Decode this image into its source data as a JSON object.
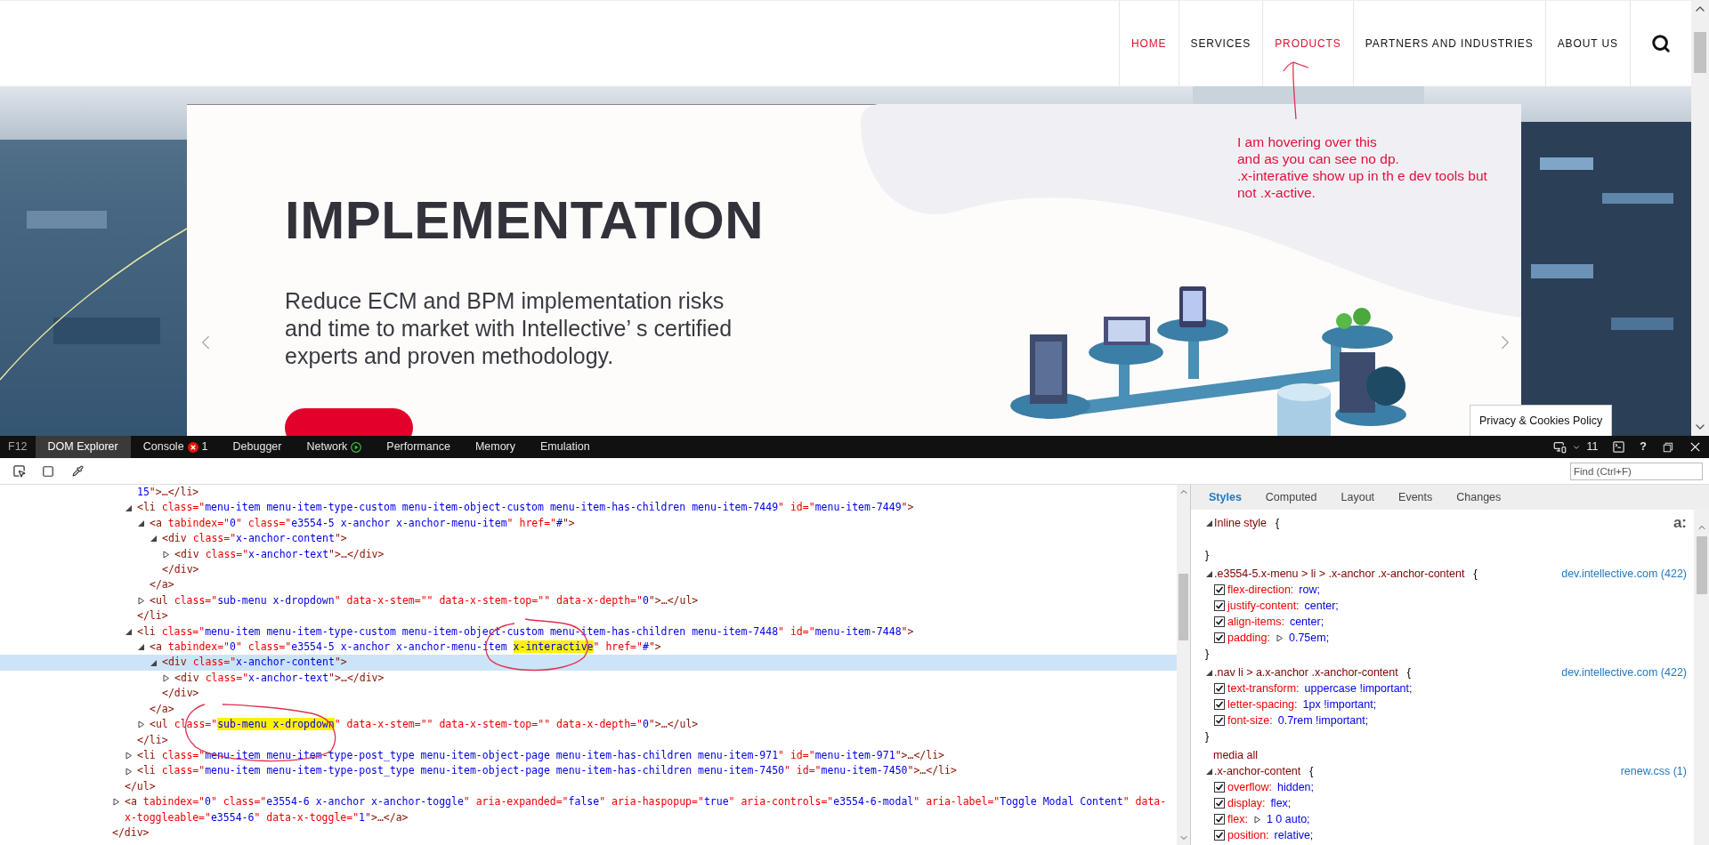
{
  "nav": {
    "items": [
      {
        "label": "HOME",
        "selected": true
      },
      {
        "label": "SERVICES",
        "selected": false
      },
      {
        "label": "PRODUCTS",
        "selected": true
      },
      {
        "label": "PARTNERS AND INDUSTRIES",
        "selected": false
      },
      {
        "label": "ABOUT US",
        "selected": false
      }
    ]
  },
  "hero": {
    "title": "IMPLEMENTATION",
    "description_lines": [
      "Reduce ECM and BPM implementation risks",
      "and time to market with Intellective’ s certified",
      "experts and proven methodology."
    ],
    "privacy_badge": "Privacy & Cookies Policy"
  },
  "annotation": {
    "note_lines": [
      "I am hovering over this",
      "and as you can see no dp.",
      ".x-interative show up in th e dev tools but",
      "not .x-active."
    ]
  },
  "devtools": {
    "f12": "F12",
    "tabs": [
      {
        "label": "DOM Explorer",
        "selected": true,
        "kind": "plain"
      },
      {
        "label": "Console",
        "selected": false,
        "kind": "errors",
        "badge": "1"
      },
      {
        "label": "Debugger",
        "selected": false,
        "kind": "plain"
      },
      {
        "label": "Network",
        "selected": false,
        "kind": "recording"
      },
      {
        "label": "Performance",
        "selected": false,
        "kind": "plain"
      },
      {
        "label": "Memory",
        "selected": false,
        "kind": "plain"
      },
      {
        "label": "Emulation",
        "selected": false,
        "kind": "plain"
      }
    ],
    "document_mode": "11",
    "help": "?",
    "find": {
      "placeholder": "Find (Ctrl+F)"
    },
    "dom_tree": [
      {
        "children": [
          {
            "children": [
              {
                "tokens": [
                  {
                    "kind": "value",
                    "text": "15"
                  },
                  {
                    "kind": "tag",
                    "text": "\">…</li>"
                  }
                ]
              },
              {
                "tokens": [
                  {
                    "kind": "tag",
                    "text": "<li"
                  },
                  {
                    "kind": "attr",
                    "text": " class=\""
                  },
                  {
                    "kind": "value",
                    "text": "menu-item menu-item-type-custom menu-item-object-custom menu-item-has-children menu-item-7449"
                  },
                  {
                    "kind": "attr",
                    "text": "\" id=\""
                  },
                  {
                    "kind": "value",
                    "text": "menu-item-7449"
                  },
                  {
                    "kind": "tag",
                    "text": "\">"
                  }
                ],
                "expanded": true,
                "selected": false,
                "close": "</li>",
                "children": [
                  {
                    "tokens": [
                      {
                        "kind": "tag",
                        "text": "<a"
                      },
                      {
                        "kind": "attr",
                        "text": " tabindex=\""
                      },
                      {
                        "kind": "value",
                        "text": "0"
                      },
                      {
                        "kind": "attr",
                        "text": "\" class=\""
                      },
                      {
                        "kind": "value",
                        "text": "e3554-5 x-anchor x-anchor-menu-item"
                      },
                      {
                        "kind": "attr",
                        "text": "\" href=\""
                      },
                      {
                        "kind": "value",
                        "text": "#"
                      },
                      {
                        "kind": "tag",
                        "text": "\">"
                      }
                    ],
                    "expanded": true,
                    "selected": false,
                    "close": "</a>",
                    "children": [
                      {
                        "tokens": [
                          {
                            "kind": "tag",
                            "text": "<div"
                          },
                          {
                            "kind": "attr",
                            "text": " class=\""
                          },
                          {
                            "kind": "value",
                            "text": "x-anchor-content"
                          },
                          {
                            "kind": "tag",
                            "text": "\">"
                          }
                        ],
                        "expanded": true,
                        "selected": false,
                        "close": "</div>",
                        "children": [
                          {
                            "tokens": [
                              {
                                "kind": "tag",
                                "text": "<div"
                              },
                              {
                                "kind": "attr",
                                "text": " class=\""
                              },
                              {
                                "kind": "value",
                                "text": "x-anchor-text"
                              },
                              {
                                "kind": "tag",
                                "text": "\">…</div>"
                              }
                            ],
                            "expanded": false,
                            "selected": false
                          }
                        ]
                      }
                    ]
                  },
                  {
                    "tokens": [
                      {
                        "kind": "tag",
                        "text": "<ul"
                      },
                      {
                        "kind": "attr",
                        "text": " class=\""
                      },
                      {
                        "kind": "value",
                        "text": "sub-menu x-dropdown"
                      },
                      {
                        "kind": "attr",
                        "text": "\" data-x-stem=\"\" data-x-stem-top=\"\" data-x-depth=\""
                      },
                      {
                        "kind": "value",
                        "text": "0"
                      },
                      {
                        "kind": "tag",
                        "text": "\">…</ul>"
                      }
                    ],
                    "expanded": false,
                    "selected": false
                  }
                ]
              },
              {
                "tokens": [
                  {
                    "kind": "tag",
                    "text": "<li"
                  },
                  {
                    "kind": "attr",
                    "text": " class=\""
                  },
                  {
                    "kind": "value",
                    "text": "menu-item menu-item-type-custom menu-item-object-custom menu-item-has-children menu-item-7448"
                  },
                  {
                    "kind": "attr",
                    "text": "\" id=\""
                  },
                  {
                    "kind": "value",
                    "text": "menu-item-7448"
                  },
                  {
                    "kind": "tag",
                    "text": "\">"
                  }
                ],
                "expanded": true,
                "selected": false,
                "close": "</li>",
                "children": [
                  {
                    "tokens": [
                      {
                        "kind": "tag",
                        "text": "<a"
                      },
                      {
                        "kind": "attr",
                        "text": " tabindex=\""
                      },
                      {
                        "kind": "value",
                        "text": "0"
                      },
                      {
                        "kind": "attr",
                        "text": "\" class=\""
                      },
                      {
                        "kind": "value",
                        "text": "e3554-5 x-anchor x-anchor-menu-item "
                      },
                      {
                        "kind": "mark",
                        "text": "x-interactive"
                      },
                      {
                        "kind": "attr",
                        "text": "\" href=\""
                      },
                      {
                        "kind": "value",
                        "text": "#"
                      },
                      {
                        "kind": "tag",
                        "text": "\">"
                      }
                    ],
                    "expanded": true,
                    "selected": false,
                    "close": "</a>",
                    "children": [
                      {
                        "tokens": [
                          {
                            "kind": "tag",
                            "text": "<div"
                          },
                          {
                            "kind": "attr",
                            "text": " class=\""
                          },
                          {
                            "kind": "value",
                            "text": "x-anchor-content"
                          },
                          {
                            "kind": "tag",
                            "text": "\">"
                          }
                        ],
                        "expanded": true,
                        "selected": true,
                        "close": "</div>",
                        "children": [
                          {
                            "tokens": [
                              {
                                "kind": "tag",
                                "text": "<div"
                              },
                              {
                                "kind": "attr",
                                "text": " class=\""
                              },
                              {
                                "kind": "value",
                                "text": "x-anchor-text"
                              },
                              {
                                "kind": "tag",
                                "text": "\">…</div>"
                              }
                            ],
                            "expanded": false,
                            "selected": false
                          }
                        ]
                      }
                    ]
                  },
                  {
                    "tokens": [
                      {
                        "kind": "tag",
                        "text": "<ul"
                      },
                      {
                        "kind": "attr",
                        "text": " class=\""
                      },
                      {
                        "kind": "mark",
                        "text": "sub-menu x-dropdown"
                      },
                      {
                        "kind": "attr",
                        "text": "\" data-x-stem=\"\" data-x-stem-top=\"\" data-x-depth=\""
                      },
                      {
                        "kind": "value",
                        "text": "0"
                      },
                      {
                        "kind": "tag",
                        "text": "\">…</ul>"
                      }
                    ],
                    "expanded": false,
                    "selected": false
                  }
                ]
              },
              {
                "tokens": [
                  {
                    "kind": "tag",
                    "text": "<li"
                  },
                  {
                    "kind": "attr",
                    "text": " class=\""
                  },
                  {
                    "kind": "value",
                    "text": "menu-item menu-item-type-post_type menu-item-object-page menu-item-has-children menu-item-971"
                  },
                  {
                    "kind": "attr",
                    "text": "\" id=\""
                  },
                  {
                    "kind": "value",
                    "text": "menu-item-971"
                  },
                  {
                    "kind": "tag",
                    "text": "\">…</li>"
                  }
                ],
                "expanded": false,
                "selected": false
              },
              {
                "tokens": [
                  {
                    "kind": "tag",
                    "text": "<li"
                  },
                  {
                    "kind": "attr",
                    "text": " class=\""
                  },
                  {
                    "kind": "value",
                    "text": "menu-item menu-item-type-post_type menu-item-object-page menu-item-has-children menu-item-7450"
                  },
                  {
                    "kind": "attr",
                    "text": "\" id=\""
                  },
                  {
                    "kind": "value",
                    "text": "menu-item-7450"
                  },
                  {
                    "kind": "tag",
                    "text": "\">…</li>"
                  }
                ],
                "expanded": false,
                "selected": false
              }
            ],
            "close": "</ul>"
          },
          {
            "tokens": [
              {
                "kind": "tag",
                "text": "<a"
              },
              {
                "kind": "attr",
                "text": " tabindex=\""
              },
              {
                "kind": "value",
                "text": "0"
              },
              {
                "kind": "attr",
                "text": "\" class=\""
              },
              {
                "kind": "value",
                "text": "e3554-6 x-anchor x-anchor-toggle"
              },
              {
                "kind": "attr",
                "text": "\" aria-expanded=\""
              },
              {
                "kind": "value",
                "text": "false"
              },
              {
                "kind": "attr",
                "text": "\" aria-haspopup=\""
              },
              {
                "kind": "value",
                "text": "true"
              },
              {
                "kind": "attr",
                "text": "\" aria-controls=\""
              },
              {
                "kind": "value",
                "text": "e3554-6-modal"
              },
              {
                "kind": "attr",
                "text": "\" aria-label=\""
              },
              {
                "kind": "value",
                "text": "Toggle Modal Content"
              },
              {
                "kind": "attr",
                "text": "\" data-x-toggleable=\""
              },
              {
                "kind": "value",
                "text": "e3554-6"
              },
              {
                "kind": "attr",
                "text": "\" data-x-toggle=\""
              },
              {
                "kind": "value",
                "text": "1"
              },
              {
                "kind": "tag",
                "text": "\">…</a>"
              }
            ],
            "expanded": false,
            "selected": false
          }
        ],
        "close": "</div>"
      }
    ],
    "styles": {
      "tabs": [
        {
          "label": "Styles",
          "selected": true
        },
        {
          "label": "Computed",
          "selected": false
        },
        {
          "label": "Layout",
          "selected": false
        },
        {
          "label": "Events",
          "selected": false
        },
        {
          "label": "Changes",
          "selected": false
        }
      ],
      "rules": [
        {
          "selector": "Inline style",
          "open": "{",
          "close": "}",
          "expanded": true,
          "pseudo_toggle": "a:"
        },
        {
          "selector": ".e3554-5.x-menu > li > .x-anchor .x-anchor-content",
          "open": "{",
          "close": "}",
          "expanded": true,
          "source": "dev.intellective.com (422)",
          "properties": [
            {
              "name": "flex-direction:",
              "value": "row;",
              "checked": true,
              "expandable": false
            },
            {
              "name": "justify-content:",
              "value": "center;",
              "checked": true,
              "expandable": false
            },
            {
              "name": "align-items:",
              "value": "center;",
              "checked": true,
              "expandable": false
            },
            {
              "name": "padding:",
              "value": "0.75em;",
              "checked": true,
              "expandable": true
            }
          ]
        },
        {
          "selector": ".nav li > a.x-anchor .x-anchor-content",
          "open": "{",
          "close": "}",
          "expanded": true,
          "source": "dev.intellective.com (422)",
          "properties": [
            {
              "name": "text-transform:",
              "value": "uppercase !important;",
              "checked": true,
              "expandable": false
            },
            {
              "name": "letter-spacing:",
              "value": "1px !important;",
              "checked": true,
              "expandable": false
            },
            {
              "name": "font-size:",
              "value": "0.7rem !important;",
              "checked": true,
              "expandable": false
            }
          ]
        },
        {
          "media": "media all",
          "selector": ".x-anchor-content",
          "open": "{",
          "expanded": true,
          "source": "renew.css (1)",
          "properties": [
            {
              "name": "overflow:",
              "value": "hidden;",
              "checked": true,
              "expandable": false
            },
            {
              "name": "display:",
              "value": "flex;",
              "checked": true,
              "expandable": false
            },
            {
              "name": "flex:",
              "value": "1 0 auto;",
              "checked": true,
              "expandable": true
            },
            {
              "name": "position:",
              "value": "relative;",
              "checked": true,
              "expandable": false
            }
          ]
        }
      ]
    }
  }
}
